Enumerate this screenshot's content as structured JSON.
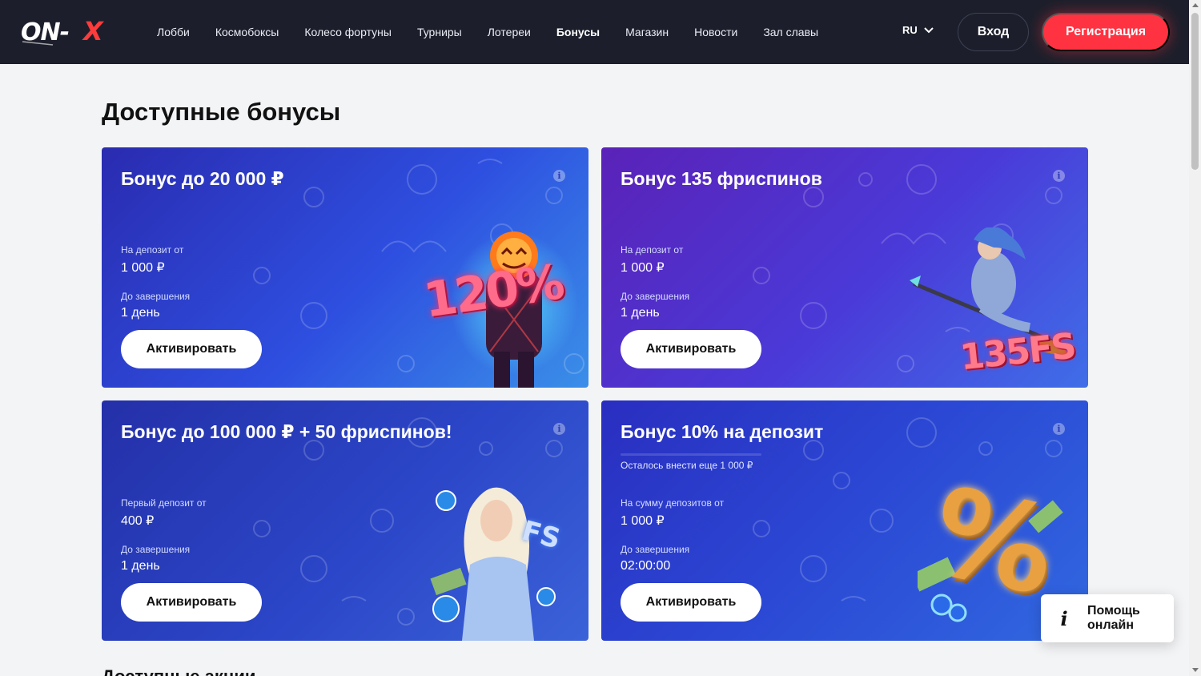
{
  "header": {
    "logo": "ON-X",
    "nav": [
      "Лобби",
      "Космобоксы",
      "Колесо фортуны",
      "Турниры",
      "Лотереи",
      "Бонусы",
      "Магазин",
      "Новости",
      "Зал славы"
    ],
    "active_nav": "Бонусы",
    "language": "RU",
    "login_label": "Вход",
    "register_label": "Регистрация"
  },
  "colors": {
    "header_bg": "#1c1f2b",
    "accent": "#ff3241",
    "page_bg": "#f3f4f6"
  },
  "main": {
    "title": "Доступные бонусы",
    "next_section_title": "Доступные акции"
  },
  "bonuses": [
    {
      "title": "Бонус до 20 000 ₽",
      "field1_label": "На депозит от",
      "field1_value": "1 000 ₽",
      "field2_label": "До завершения",
      "field2_value": "1 день",
      "button": "Активировать",
      "art_text": "120%"
    },
    {
      "title": "Бонус 135 фриспинов",
      "field1_label": "На депозит от",
      "field1_value": "1 000 ₽",
      "field2_label": "До завершения",
      "field2_value": "1 день",
      "button": "Активировать",
      "art_text": "135FS"
    },
    {
      "title": "Бонус до 100 000 ₽ + 50 фриспинов!",
      "field1_label": "Первый депозит от",
      "field1_value": "400 ₽",
      "field2_label": "До завершения",
      "field2_value": "1 день",
      "button": "Активировать",
      "art_text": "FS"
    },
    {
      "title": "Бонус 10% на депозит",
      "progress_text": "Осталось внести еще 1 000 ₽",
      "field1_label": "На сумму депозитов от",
      "field1_value": "1 000 ₽",
      "field2_label": "До завершения",
      "field2_value": "02:00:00",
      "button": "Активировать",
      "art_text": "%"
    }
  ],
  "help": {
    "icon": "info-icon",
    "label_line1": "Помощь",
    "label_line2": "онлайн"
  }
}
